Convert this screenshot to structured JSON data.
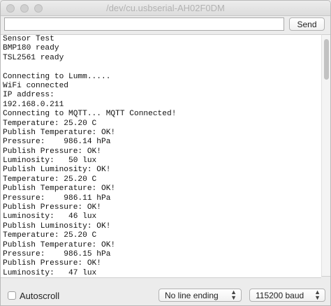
{
  "window": {
    "title": "/dev/cu.usbserial-AH02F0DM"
  },
  "send": {
    "input_value": "",
    "button_label": "Send"
  },
  "output_lines": [
    "Sensor Test",
    "BMP180 ready",
    "TSL2561 ready",
    "",
    "Connecting to Lumm.....",
    "WiFi connected",
    "IP address:",
    "192.168.0.211",
    "Connecting to MQTT... MQTT Connected!",
    "Temperature: 25.20 C",
    "Publish Temperature: OK!",
    "Pressure:    986.14 hPa",
    "Publish Pressure: OK!",
    "Luminosity:   50 lux",
    "Publish Luminosity: OK!",
    "Temperature: 25.20 C",
    "Publish Temperature: OK!",
    "Pressure:    986.11 hPa",
    "Publish Pressure: OK!",
    "Luminosity:   46 lux",
    "Publish Luminosity: OK!",
    "Temperature: 25.20 C",
    "Publish Temperature: OK!",
    "Pressure:    986.15 hPa",
    "Publish Pressure: OK!",
    "Luminosity:   47 lux"
  ],
  "footer": {
    "autoscroll_label": "Autoscroll",
    "autoscroll_checked": false,
    "line_ending": "No line ending",
    "baud_rate": "115200 baud"
  }
}
